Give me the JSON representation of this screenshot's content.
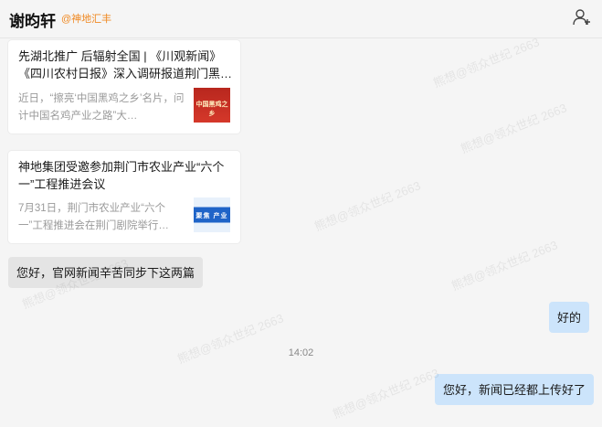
{
  "header": {
    "name": "谢昀轩",
    "tag": "@神地汇丰"
  },
  "cards": [
    {
      "title": "先湖北推广 后辐射全国 | 《川观新闻》《四川农村日报》深入调研报道荆门黑…",
      "desc": "近日，“擦亮‘中国黑鸡之乡’名片，问计中国名鸡产业之路”大…",
      "thumb_text": "中国黑鸡之乡"
    },
    {
      "title": "神地集团受邀参加荆门市农业产业“六个一”工程推进会议",
      "desc": "7月31日，荆门市农业产业“六个一”工程推进会在荆门剧院举行…",
      "thumb_text": "聚焦 产业"
    }
  ],
  "messages": {
    "incoming": "您好，官网新闻辛苦同步下这两篇",
    "reply1": "好的",
    "time": "14:02",
    "reply2": "您好，新闻已经都上传好了"
  },
  "watermark": "熊想@领众世纪 2663",
  "colors": {
    "tag": "#f08a24",
    "outgoing_bubble": "#cce4fb",
    "incoming_bubble": "#e4e4e4"
  }
}
